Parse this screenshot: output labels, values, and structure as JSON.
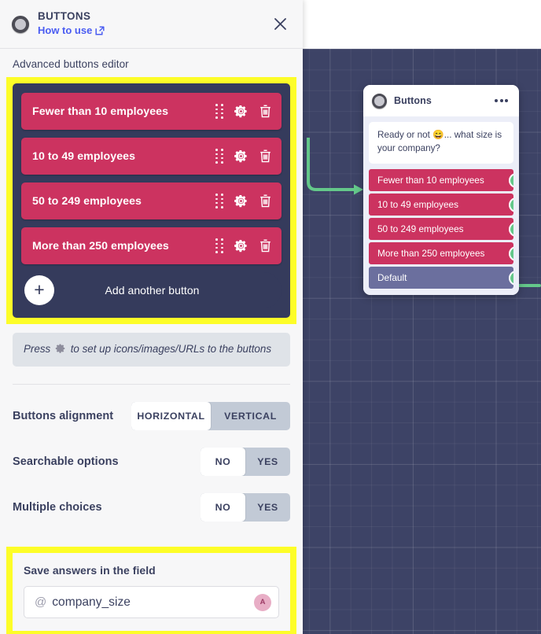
{
  "panel": {
    "icon": "radio-ring-icon",
    "title": "BUTTONS",
    "how_to_use": "How to use",
    "how_to_use_icon": "external-link-icon",
    "close_icon": "close-icon",
    "section_title": "Advanced buttons editor",
    "editor": {
      "buttons": [
        {
          "label": "Fewer than 10 employees"
        },
        {
          "label": "10 to 49 employees"
        },
        {
          "label": "50 to 249 employees"
        },
        {
          "label": "More than 250 employees"
        }
      ],
      "row_icons": [
        "drag-handle-icon",
        "gear-icon",
        "trash-icon"
      ],
      "add_label": "Add another button",
      "add_icon": "plus-icon"
    },
    "hint": {
      "before": "Press",
      "icon": "gear-icon",
      "after": "to set up icons/images/URLs to the buttons"
    },
    "options": [
      {
        "label": "Buttons alignment",
        "name": "buttons-alignment",
        "choices": [
          "HORIZONTAL",
          "VERTICAL"
        ],
        "selected": "HORIZONTAL"
      },
      {
        "label": "Searchable options",
        "name": "searchable-options",
        "choices": [
          "NO",
          "YES"
        ],
        "selected": "NO"
      },
      {
        "label": "Multiple choices",
        "name": "multiple-choices",
        "choices": [
          "NO",
          "YES"
        ],
        "selected": "NO"
      }
    ],
    "save": {
      "label": "Save answers in the field",
      "at_symbol": "@",
      "value": "company_size",
      "avatar_initial": "A"
    }
  },
  "node": {
    "icon": "radio-ring-icon",
    "title": "Buttons",
    "menu_icon": "more-options-icon",
    "message": "Ready or not 😄... what size is your company?",
    "buttons": [
      {
        "label": "Fewer than 10 employees",
        "kind": "option"
      },
      {
        "label": "10 to 49 employees",
        "kind": "option"
      },
      {
        "label": "50 to 249 employees",
        "kind": "option"
      },
      {
        "label": "More than 250 employees",
        "kind": "option"
      },
      {
        "label": "Default",
        "kind": "default"
      }
    ]
  },
  "colors": {
    "accent_pink": "#cc3360",
    "default_slate": "#6b6f9e",
    "connector_green": "#64c88a",
    "highlight_yellow": "#fdfd28",
    "editor_dark": "#353b5c",
    "canvas": "#3d4366",
    "link_blue": "#4a5cf2"
  }
}
